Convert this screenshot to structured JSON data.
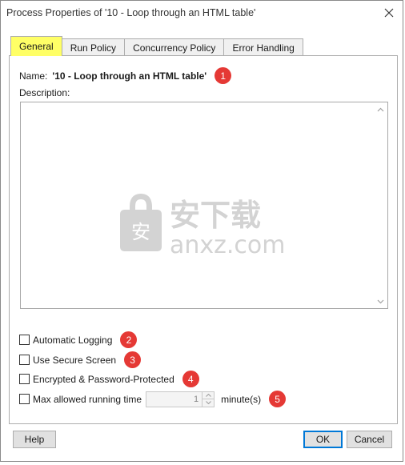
{
  "window": {
    "title": "Process Properties of '10 - Loop through an HTML table'"
  },
  "tabs": [
    {
      "label": "General",
      "active": true
    },
    {
      "label": "Run Policy",
      "active": false
    },
    {
      "label": "Concurrency Policy",
      "active": false
    },
    {
      "label": "Error Handling",
      "active": false
    }
  ],
  "general": {
    "name_label": "Name:",
    "name_value": "'10 - Loop through an HTML table'",
    "description_label": "Description:",
    "description_value": "",
    "options": [
      {
        "label": "Automatic Logging",
        "checked": false
      },
      {
        "label": "Use Secure Screen",
        "checked": false
      },
      {
        "label": "Encrypted & Password-Protected",
        "checked": false
      },
      {
        "label": "Max allowed running time",
        "checked": false
      }
    ],
    "max_time_value": "1",
    "max_time_unit": "minute(s)"
  },
  "annotations": [
    "1",
    "2",
    "3",
    "4",
    "5"
  ],
  "watermark": {
    "cn_text": "安下载",
    "en_text": "anxz.com",
    "shield_glyph": "安"
  },
  "buttons": {
    "help": "Help",
    "ok": "OK",
    "cancel": "Cancel"
  },
  "colors": {
    "active_tab": "#ffff66",
    "annotation_badge": "#e53935",
    "default_button_border": "#0078d7"
  }
}
